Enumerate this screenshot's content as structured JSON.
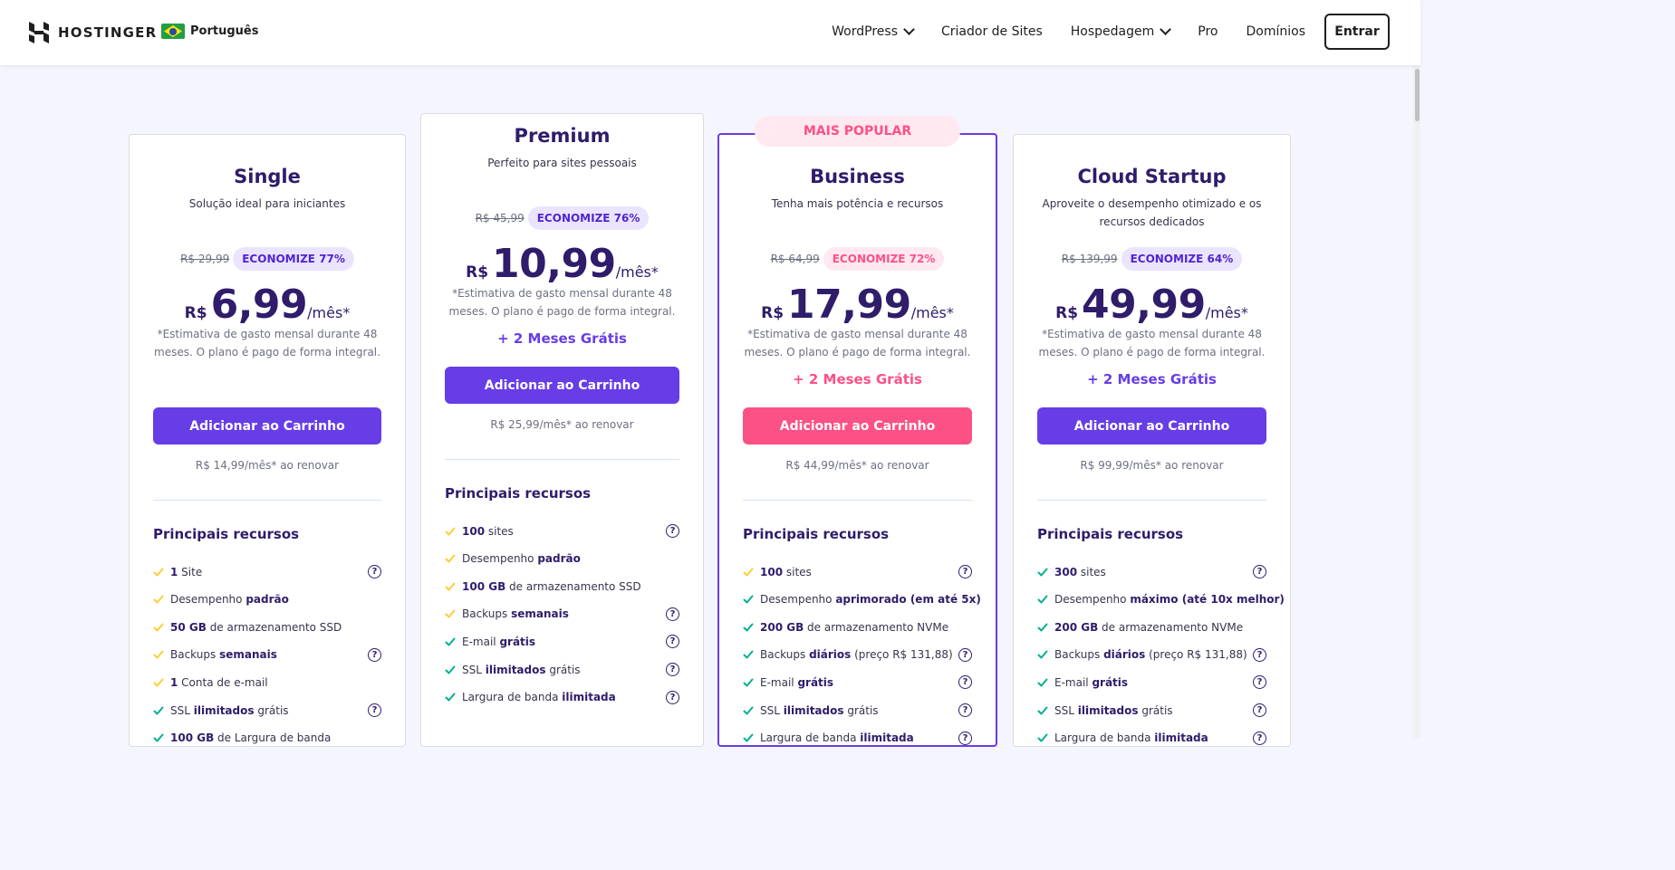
{
  "nav": {
    "brand": "HOSTINGER",
    "language": "Português",
    "menu": [
      {
        "label": "WordPress",
        "dropdown": true
      },
      {
        "label": "Criador de Sites",
        "dropdown": false
      },
      {
        "label": "Hospedagem",
        "dropdown": true
      },
      {
        "label": "Pro",
        "dropdown": false
      },
      {
        "label": "Domínios",
        "dropdown": false
      }
    ],
    "login": "Entrar"
  },
  "popular_tag": "MAIS POPULAR",
  "colors": {
    "primary": "#673de6",
    "accent_pink": "#fc5185",
    "check_yellow": "#ffcd35",
    "check_green": "#00b090",
    "dark": "#2f1c6a"
  },
  "plans": [
    {
      "name": "Single",
      "subtitle": "Solução ideal para iniciantes",
      "old_price": "R$ 29,99",
      "save": "ECONOMIZE 77%",
      "currency": "R$",
      "price": "6,99",
      "period": "/mês*",
      "note": "*Estimativa de gasto mensal durante 48 meses. O plano é pago de forma integral.",
      "bonus": "",
      "cta": "Adicionar ao Carrinho",
      "renew": "R$ 14,99/mês* ao renovar",
      "features_title": "Principais recursos",
      "features": [
        {
          "check": "yellow",
          "bold": "1",
          "text": " Site",
          "help": true
        },
        {
          "check": "yellow",
          "pre": "Desempenho ",
          "bold": "padrão",
          "help": false
        },
        {
          "check": "yellow",
          "bold": "50 GB",
          "text": " de armazenamento SSD",
          "help": false
        },
        {
          "check": "yellow",
          "pre": "Backups ",
          "bold": "semanais",
          "help": true
        },
        {
          "check": "yellow",
          "bold": "1",
          "text": " Conta de e-mail",
          "help": false
        },
        {
          "check": "green",
          "pre": "SSL ",
          "bold": "ilimitados",
          "text": " grátis",
          "help": true
        },
        {
          "check": "green",
          "bold": "100 GB",
          "text": " de Largura de banda",
          "help": false
        }
      ]
    },
    {
      "name": "Premium",
      "subtitle": "Perfeito para sites pessoais",
      "old_price": "R$ 45,99",
      "save": "ECONOMIZE 76%",
      "currency": "R$",
      "price": "10,99",
      "period": "/mês*",
      "note": "*Estimativa de gasto mensal durante 48 meses. O plano é pago de forma integral.",
      "bonus": "+ 2 Meses Grátis",
      "cta": "Adicionar ao Carrinho",
      "renew": "R$ 25,99/mês* ao renovar",
      "features_title": "Principais recursos",
      "features": [
        {
          "check": "yellow",
          "bold": "100",
          "text": " sites",
          "help": true
        },
        {
          "check": "yellow",
          "pre": "Desempenho ",
          "bold": "padrão",
          "help": false
        },
        {
          "check": "yellow",
          "bold": "100 GB",
          "text": " de armazenamento SSD",
          "help": false
        },
        {
          "check": "yellow",
          "pre": "Backups ",
          "bold": "semanais",
          "help": true
        },
        {
          "check": "green",
          "pre": "E-mail ",
          "bold": "grátis",
          "help": true
        },
        {
          "check": "green",
          "pre": "SSL ",
          "bold": "ilimitados",
          "text": " grátis",
          "help": true
        },
        {
          "check": "green",
          "pre": "Largura de banda ",
          "bold": "ilimitada",
          "help": true
        }
      ]
    },
    {
      "name": "Business",
      "subtitle": "Tenha mais potência e recursos",
      "old_price": "R$ 64,99",
      "save": "ECONOMIZE 72%",
      "currency": "R$",
      "price": "17,99",
      "period": "/mês*",
      "note": "*Estimativa de gasto mensal durante 48 meses. O plano é pago de forma integral.",
      "bonus": "+ 2 Meses Grátis",
      "cta": "Adicionar ao Carrinho",
      "renew": "R$ 44,99/mês* ao renovar",
      "features_title": "Principais recursos",
      "features": [
        {
          "check": "yellow",
          "bold": "100",
          "text": " sites",
          "help": true
        },
        {
          "check": "green",
          "pre": "Desempenho ",
          "bold": "aprimorado (em até 5x)",
          "help": false
        },
        {
          "check": "green",
          "bold": "200 GB",
          "text": " de armazenamento NVMe",
          "help": false
        },
        {
          "check": "green",
          "pre": "Backups ",
          "bold": "diários",
          "text": " (preço R$ 131,88)",
          "help": true
        },
        {
          "check": "green",
          "pre": "E-mail ",
          "bold": "grátis",
          "help": true
        },
        {
          "check": "green",
          "pre": "SSL ",
          "bold": "ilimitados",
          "text": " grátis",
          "help": true
        },
        {
          "check": "green",
          "pre": "Largura de banda ",
          "bold": "ilimitada",
          "help": true
        }
      ]
    },
    {
      "name": "Cloud Startup",
      "subtitle": "Aproveite o desempenho otimizado e os recursos dedicados",
      "old_price": "R$ 139,99",
      "save": "ECONOMIZE 64%",
      "currency": "R$",
      "price": "49,99",
      "period": "/mês*",
      "note": "*Estimativa de gasto mensal durante 48 meses. O plano é pago de forma integral.",
      "bonus": "+ 2 Meses Grátis",
      "cta": "Adicionar ao Carrinho",
      "renew": "R$ 99,99/mês* ao renovar",
      "features_title": "Principais recursos",
      "features": [
        {
          "check": "green",
          "bold": "300",
          "text": " sites",
          "help": true
        },
        {
          "check": "green",
          "pre": "Desempenho ",
          "bold": "máximo (até 10x melhor)",
          "help": false
        },
        {
          "check": "green",
          "bold": "200 GB",
          "text": " de armazenamento NVMe",
          "help": false
        },
        {
          "check": "green",
          "pre": "Backups ",
          "bold": "diários",
          "text": " (preço R$ 131,88)",
          "help": true
        },
        {
          "check": "green",
          "pre": "E-mail ",
          "bold": "grátis",
          "help": true
        },
        {
          "check": "green",
          "pre": "SSL ",
          "bold": "ilimitados",
          "text": " grátis",
          "help": true
        },
        {
          "check": "green",
          "pre": "Largura de banda ",
          "bold": "ilimitada",
          "help": true
        }
      ]
    }
  ]
}
